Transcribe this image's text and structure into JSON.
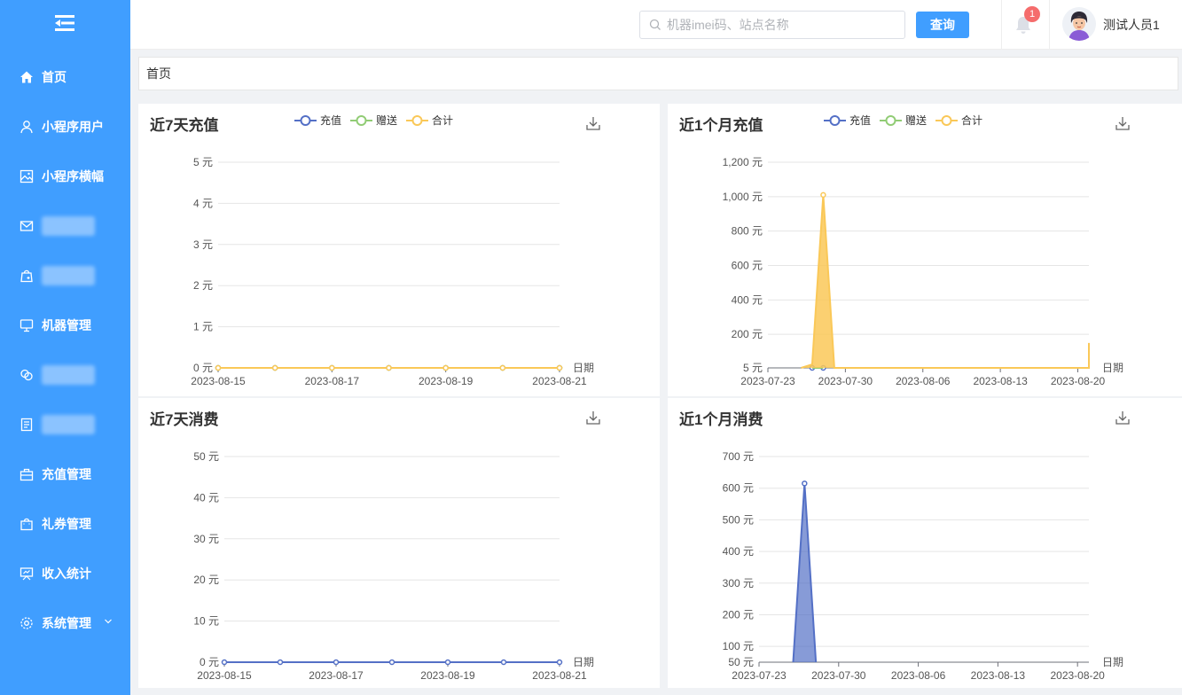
{
  "sidebar": {
    "items": [
      {
        "label": "首页",
        "icon": "home-icon",
        "blurred": false
      },
      {
        "label": "小程序用户",
        "icon": "user-icon",
        "blurred": false
      },
      {
        "label": "小程序横幅",
        "icon": "image-icon",
        "blurred": false
      },
      {
        "label": "",
        "icon": "mail-icon",
        "blurred": true
      },
      {
        "label": "",
        "icon": "shopping-bag-icon",
        "blurred": true
      },
      {
        "label": "机器管理",
        "icon": "monitor-icon",
        "blurred": false
      },
      {
        "label": "",
        "icon": "link-icon",
        "blurred": true
      },
      {
        "label": "",
        "icon": "document-icon",
        "blurred": true
      },
      {
        "label": "充值管理",
        "icon": "briefcase-icon",
        "blurred": false
      },
      {
        "label": "礼券管理",
        "icon": "gift-bag-icon",
        "blurred": false
      },
      {
        "label": "收入统计",
        "icon": "presentation-icon",
        "blurred": false
      },
      {
        "label": "系统管理",
        "icon": "gear-icon",
        "blurred": false,
        "has_submenu": true
      }
    ]
  },
  "header": {
    "search_placeholder": "机器imei码、站点名称",
    "query_label": "查询",
    "notification_count": "1",
    "user_name": "测试人员1"
  },
  "breadcrumb": {
    "label": "首页"
  },
  "colors": {
    "accent": "#409eff",
    "recharge": "#5470c6",
    "gift": "#91cc75",
    "total": "#fac858"
  },
  "charts": [
    {
      "title": "近7天充值",
      "legend": [
        "充值",
        "赠送",
        "合计"
      ],
      "chart_data": {
        "type": "line",
        "x": [
          "2023-08-15",
          "2023-08-16",
          "2023-08-17",
          "2023-08-18",
          "2023-08-19",
          "2023-08-20",
          "2023-08-21"
        ],
        "x_tick_labels": [
          "2023-08-15",
          "2023-08-17",
          "2023-08-19",
          "2023-08-21"
        ],
        "xlabel": "日期",
        "y_ticks": [
          0,
          1,
          2,
          3,
          4,
          5
        ],
        "y_unit": "元",
        "ylim": [
          0,
          5
        ],
        "series": [
          {
            "name": "充值",
            "values": [
              0,
              0,
              0,
              0,
              0,
              0,
              0
            ]
          },
          {
            "name": "赠送",
            "values": [
              0,
              0,
              0,
              0,
              0,
              0,
              0
            ]
          },
          {
            "name": "合计",
            "values": [
              0,
              0,
              0,
              0,
              0,
              0,
              0
            ]
          }
        ]
      }
    },
    {
      "title": "近1个月充值",
      "legend": [
        "充值",
        "赠送",
        "合计"
      ],
      "chart_data": {
        "type": "area",
        "x_start": "2023-07-23",
        "x_end": "2023-08-21",
        "x_tick_labels": [
          "2023-07-23",
          "2023-07-30",
          "2023-08-06",
          "2023-08-13",
          "2023-08-20"
        ],
        "xlabel": "日期",
        "y_ticks": [
          5,
          200,
          400,
          600,
          800,
          1000,
          1200
        ],
        "y_unit": "元",
        "ylim": [
          5,
          1200
        ],
        "series": [
          {
            "name": "充值",
            "points": [
              [
                "2023-07-27",
                5
              ],
              [
                "2023-07-28",
                5
              ]
            ]
          },
          {
            "name": "赠送",
            "points": [
              [
                "2023-07-27",
                5
              ],
              [
                "2023-07-28",
                5
              ]
            ]
          },
          {
            "name": "合计",
            "points": [
              [
                "2023-07-26",
                5
              ],
              [
                "2023-07-27",
                25
              ],
              [
                "2023-07-28",
                1010
              ],
              [
                "2023-07-29",
                5
              ],
              [
                "2023-08-21",
                5
              ],
              [
                "2023-08-21",
                150
              ]
            ]
          }
        ]
      }
    },
    {
      "title": "近7天消费",
      "legend": [],
      "chart_data": {
        "type": "line",
        "x": [
          "2023-08-15",
          "2023-08-16",
          "2023-08-17",
          "2023-08-18",
          "2023-08-19",
          "2023-08-20",
          "2023-08-21"
        ],
        "x_tick_labels": [
          "2023-08-15",
          "2023-08-17",
          "2023-08-19",
          "2023-08-21"
        ],
        "xlabel": "日期",
        "y_ticks": [
          0,
          10,
          20,
          30,
          40,
          50
        ],
        "y_unit": "元",
        "ylim": [
          0,
          50
        ],
        "series": [
          {
            "values": [
              0,
              0,
              0,
              0,
              0,
              0,
              0
            ]
          }
        ]
      }
    },
    {
      "title": "近1个月消费",
      "legend": [],
      "chart_data": {
        "type": "area",
        "x_start": "2023-07-23",
        "x_end": "2023-08-21",
        "x_tick_labels": [
          "2023-07-23",
          "2023-07-30",
          "2023-08-06",
          "2023-08-13",
          "2023-08-20"
        ],
        "xlabel": "日期",
        "y_ticks": [
          50,
          100,
          200,
          300,
          400,
          500,
          600,
          700
        ],
        "y_unit": "元",
        "ylim": [
          50,
          700
        ],
        "series": [
          {
            "points": [
              [
                "2023-07-26",
                50
              ],
              [
                "2023-07-27",
                615
              ],
              [
                "2023-07-28",
                50
              ]
            ]
          }
        ]
      }
    }
  ]
}
